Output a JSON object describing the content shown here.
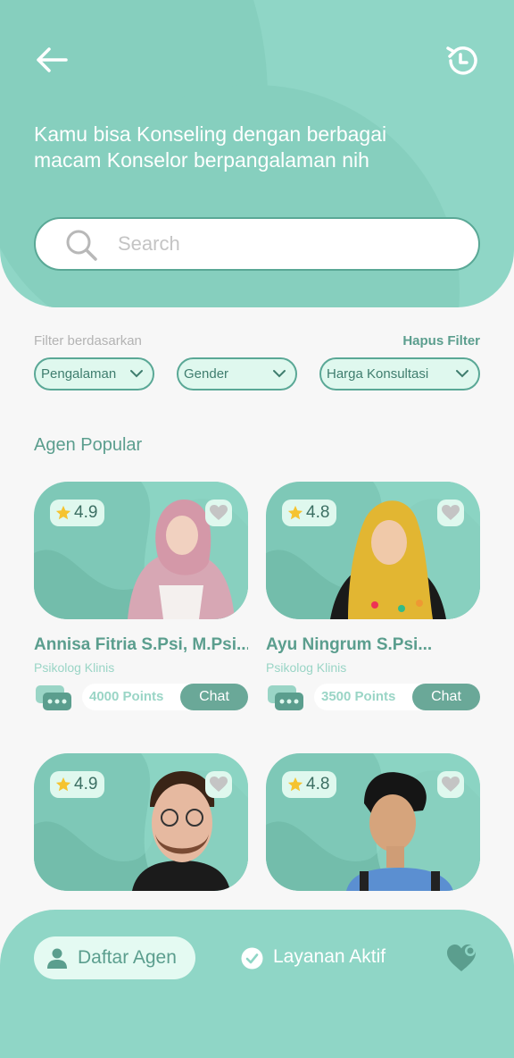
{
  "header": {
    "headline_line1": "Kamu bisa Konseling dengan berbagai",
    "headline_line2": "macam Konselor berpangalaman nih",
    "back_icon": "arrow-left-icon",
    "history_icon": "history-icon"
  },
  "search": {
    "placeholder": "Search",
    "value": ""
  },
  "filter": {
    "label": "Filter berdasarkan",
    "clear_label": "Hapus Filter",
    "options": [
      "Pengalaman",
      "Gender",
      "Harga Konsultasi"
    ]
  },
  "popular": {
    "title": "Agen Popular",
    "agents": [
      {
        "rating": "4.9",
        "name": "Annisa Fitria S.Psi, M.Psi...",
        "role": "Psikolog Klinis",
        "price": "4000 Points",
        "chat_label": "Chat"
      },
      {
        "rating": "4.8",
        "name": "Ayu Ningrum S.Psi...",
        "role": "Psikolog Klinis",
        "price": "3500 Points",
        "chat_label": "Chat"
      },
      {
        "rating": "4.9",
        "name": "",
        "role": "",
        "price": "",
        "chat_label": ""
      },
      {
        "rating": "4.8",
        "name": "",
        "role": "",
        "price": "",
        "chat_label": ""
      }
    ]
  },
  "nav": {
    "agents_label": "Daftar Agen",
    "active_label": "Layanan Aktif"
  },
  "colors": {
    "primary": "#8fd6c6",
    "accent": "#5b9e8e",
    "chat_button": "#6aa898",
    "pill_bg": "#dff8ee",
    "star": "#f5c330"
  }
}
